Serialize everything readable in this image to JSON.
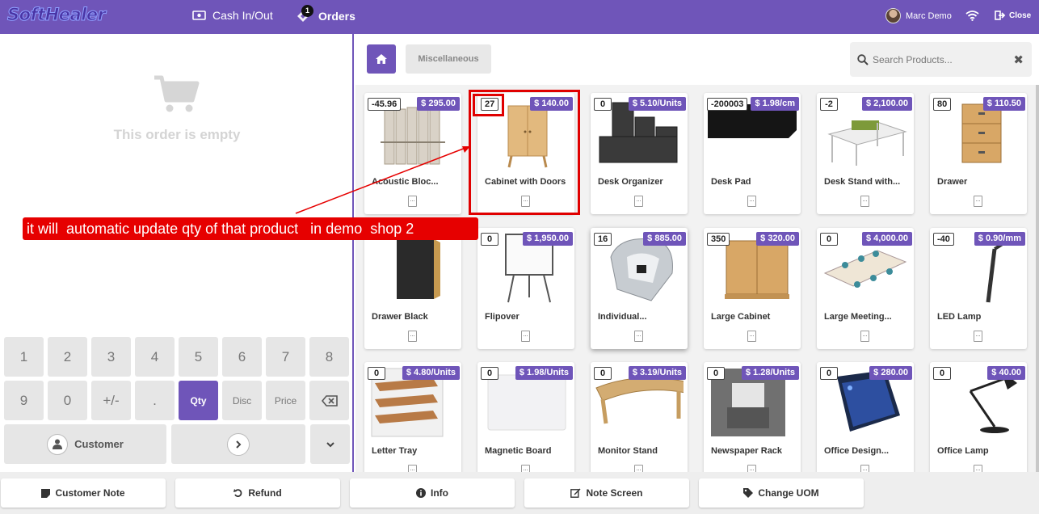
{
  "header": {
    "logo": "SoftHealer",
    "cash_label": "Cash In/Out",
    "orders_label": "Orders",
    "orders_badge": "1",
    "user_name": "Marc Demo",
    "close_label": "Close"
  },
  "order": {
    "empty_text": "This order is empty"
  },
  "numpad": {
    "keys": [
      "1",
      "2",
      "3",
      "4",
      "5",
      "6",
      "7",
      "8",
      "9",
      "0",
      "+/-",
      ".",
      "Qty",
      "Disc",
      "Price"
    ],
    "customer_label": "Customer"
  },
  "categories": {
    "current": "Miscellaneous"
  },
  "search": {
    "placeholder": "Search Products..."
  },
  "products": [
    {
      "name": "Acoustic Bloc...",
      "qty": "-45.96",
      "price": "$ 295.00"
    },
    {
      "name": "Cabinet with Doors",
      "qty": "27",
      "price": "$ 140.00"
    },
    {
      "name": "Desk Organizer",
      "qty": "0",
      "price": "$ 5.10/Units"
    },
    {
      "name": "Desk Pad",
      "qty": "-200003",
      "price": "$ 1.98/cm"
    },
    {
      "name": "Desk Stand with...",
      "qty": "-2",
      "price": "$ 2,100.00"
    },
    {
      "name": "Drawer",
      "qty": "80",
      "price": "$ 110.50"
    },
    {
      "name": "Drawer Black",
      "qty": "",
      "price": ""
    },
    {
      "name": "Flipover",
      "qty": "0",
      "price": "$ 1,950.00"
    },
    {
      "name": "Individual...",
      "qty": "16",
      "price": "$ 885.00"
    },
    {
      "name": "Large Cabinet",
      "qty": "350",
      "price": "$ 320.00"
    },
    {
      "name": "Large Meeting...",
      "qty": "0",
      "price": "$ 4,000.00"
    },
    {
      "name": "LED Lamp",
      "qty": "-40",
      "price": "$ 0.90/mm"
    },
    {
      "name": "Letter Tray",
      "qty": "0",
      "price": "$ 4.80/Units"
    },
    {
      "name": "Magnetic Board",
      "qty": "0",
      "price": "$ 1.98/Units"
    },
    {
      "name": "Monitor Stand",
      "qty": "0",
      "price": "$ 3.19/Units"
    },
    {
      "name": "Newspaper Rack",
      "qty": "0",
      "price": "$ 1.28/Units"
    },
    {
      "name": "Office Design...",
      "qty": "0",
      "price": "$ 280.00"
    },
    {
      "name": "Office Lamp",
      "qty": "0",
      "price": "$ 40.00"
    }
  ],
  "annotation": {
    "text": "it will  automatic update qty of that product   in demo  shop 2"
  },
  "footer": {
    "customer_note": "Customer Note",
    "refund": "Refund",
    "info": "Info",
    "note_screen": "Note Screen",
    "change_uom": "Change UOM"
  },
  "colors": {
    "brand": "#6f55b9",
    "annotation": "#e60000"
  }
}
